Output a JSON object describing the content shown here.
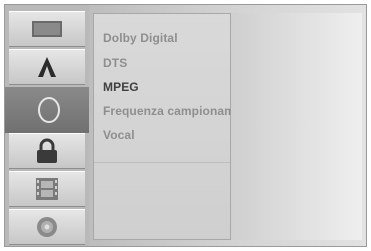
{
  "sidebar": {
    "items": [
      {
        "name": "disc-icon-tile"
      },
      {
        "name": "language-icon"
      },
      {
        "name": "audio-circle-icon"
      },
      {
        "name": "lock-icon"
      },
      {
        "name": "film-icon"
      },
      {
        "name": "cd-icon"
      }
    ],
    "selected_index": 2
  },
  "submenu": {
    "items": [
      {
        "label": "Dolby Digital"
      },
      {
        "label": "DTS"
      },
      {
        "label": "MPEG"
      },
      {
        "label": "Frequenza campionam"
      },
      {
        "label": "Vocal"
      }
    ],
    "active_index": 2
  },
  "colors": {
    "sidebar_bg": "#b9b9b9",
    "selected_tile": "#7a7a7a",
    "menu_text": "#8e8e8e",
    "menu_text_active": "#404040"
  }
}
